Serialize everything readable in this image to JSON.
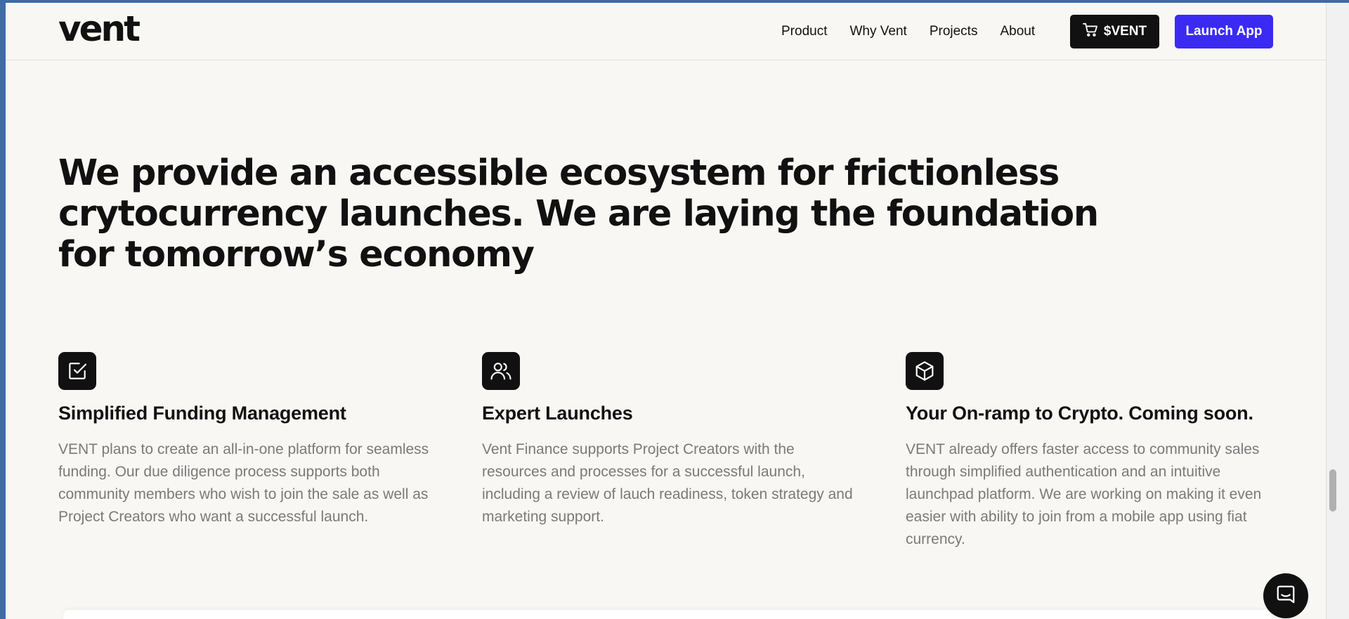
{
  "nav": {
    "logo": "vent",
    "links": [
      "Product",
      "Why Vent",
      "Projects",
      "About"
    ],
    "token_button": "$VENT",
    "launch_button": "Launch App"
  },
  "hero": {
    "headline": "We provide an accessible ecosystem for frictionless crytocurrency launches. We are laying the foundation for tomorrow’s economy"
  },
  "features": [
    {
      "icon": "checkbox-icon",
      "title": "Simplified Funding Management",
      "description": "VENT plans to create an all-in-one platform for seamless funding. Our due diligence process supports both community members who wish to join the sale as well as Project Creators who want a successful launch."
    },
    {
      "icon": "users-icon",
      "title": "Expert Launches",
      "description": "Vent Finance supports Project Creators with the resources and processes for a successful launch, including a review of lauch readiness, token strategy and marketing support."
    },
    {
      "icon": "cube-icon",
      "title": "Your On-ramp to Crypto. Coming soon.",
      "description": "VENT already offers faster access to community sales through simplified authentication and an intuitive launchpad platform. We are working on making it even easier with ability to join from a mobile app using fiat currency."
    }
  ],
  "colors": {
    "accent": "#3b2bf2",
    "dark": "#111111",
    "background": "#f8f7f4",
    "muted_text": "#7a7a7a"
  }
}
